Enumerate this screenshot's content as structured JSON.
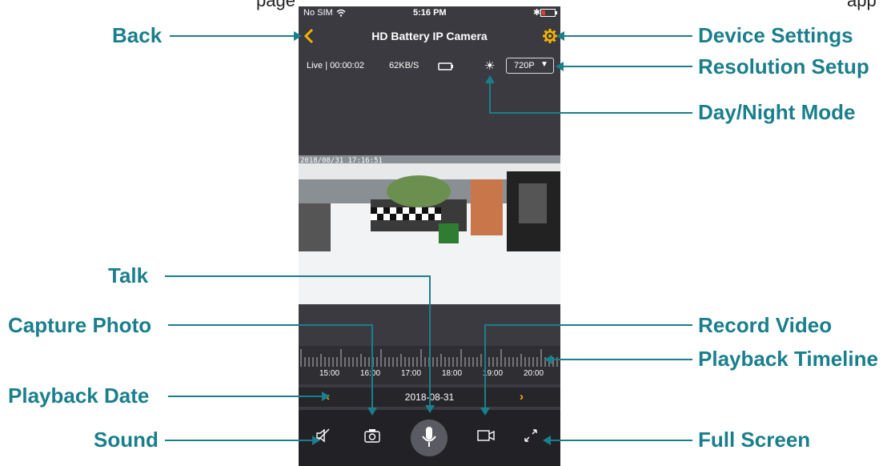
{
  "page": {
    "cut_text_left": "page",
    "cut_text_right": "app"
  },
  "status_bar": {
    "carrier": "No SIM",
    "time": "5:16 PM"
  },
  "nav": {
    "title": "HD Battery IP Camera"
  },
  "stream": {
    "live": "Live | 00:00:02",
    "rate": "62KB/S",
    "resolution": "720P"
  },
  "video": {
    "timestamp": "2018/08/31 17:16:51"
  },
  "timeline": {
    "ticks": [
      "15:00",
      "16:00",
      "17:00",
      "18:00",
      "19:00",
      "20:00"
    ]
  },
  "date_bar": {
    "date": "2018-08-31"
  },
  "labels": {
    "back": "Back",
    "device_settings": "Device Settings",
    "resolution_setup": "Resolution Setup",
    "day_night": "Day/Night Mode",
    "talk": "Talk",
    "capture_photo": "Capture Photo",
    "record_video": "Record Video",
    "playback_timeline": "Playback Timeline",
    "playback_date": "Playback Date",
    "sound": "Sound",
    "full_screen": "Full Screen"
  },
  "colors": {
    "label": "#1a7f8c",
    "accent": "#f4b400",
    "phone_bg": "#3a3a40"
  },
  "icons": [
    "back-chevron-icon",
    "gear-icon",
    "battery-icon",
    "sun-icon",
    "dropdown-arrow-icon",
    "mute-speaker-icon",
    "camera-icon",
    "microphone-icon",
    "video-camera-icon",
    "fullscreen-icon"
  ]
}
